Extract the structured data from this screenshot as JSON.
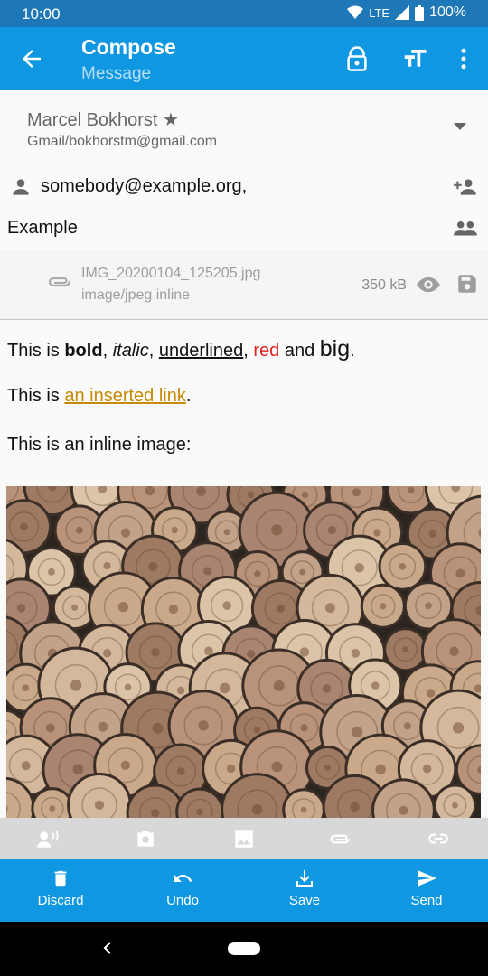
{
  "status_bar": {
    "time": "10:00",
    "network": "LTE",
    "battery": "100%"
  },
  "app_bar": {
    "title": "Compose",
    "subtitle": "Message"
  },
  "from": {
    "name": "Marcel Bokhorst ★",
    "account": "Gmail/bokhorstm@gmail.com"
  },
  "to": {
    "value": "somebody@example.org,"
  },
  "subject": {
    "value": "Example"
  },
  "attachment": {
    "filename": "IMG_20200104_125205.jpg",
    "type": "image/jpeg inline",
    "size": "350 kB"
  },
  "body": {
    "line1": {
      "prefix": "This is ",
      "bold": "bold",
      "sep1": ", ",
      "italic": "italic",
      "sep2": ", ",
      "underlined": "underlined",
      "sep3": ", ",
      "red": "red",
      "and": " and ",
      "big": "big",
      "end": "."
    },
    "line2": {
      "prefix": "This is ",
      "link": "an inserted link",
      "end": "."
    },
    "line3": "This is an inline image:"
  },
  "icons": [
    "back-arrow-icon",
    "lock-open-icon",
    "text-size-icon",
    "more-vert-icon",
    "person-icon",
    "person-add-icon",
    "group-icon",
    "paperclip-icon",
    "eye-icon",
    "save-icon",
    "record-audio-icon",
    "camera-icon",
    "image-icon",
    "attach-icon",
    "link-icon",
    "trash-icon",
    "undo-icon",
    "download-icon",
    "send-icon"
  ],
  "actions": {
    "discard": "Discard",
    "undo": "Undo",
    "save": "Save",
    "send": "Send"
  },
  "colors": {
    "primary": "#0f98e1",
    "status_bar": "#1e78b8",
    "link": "#c68a00",
    "red_text": "#e02020"
  }
}
